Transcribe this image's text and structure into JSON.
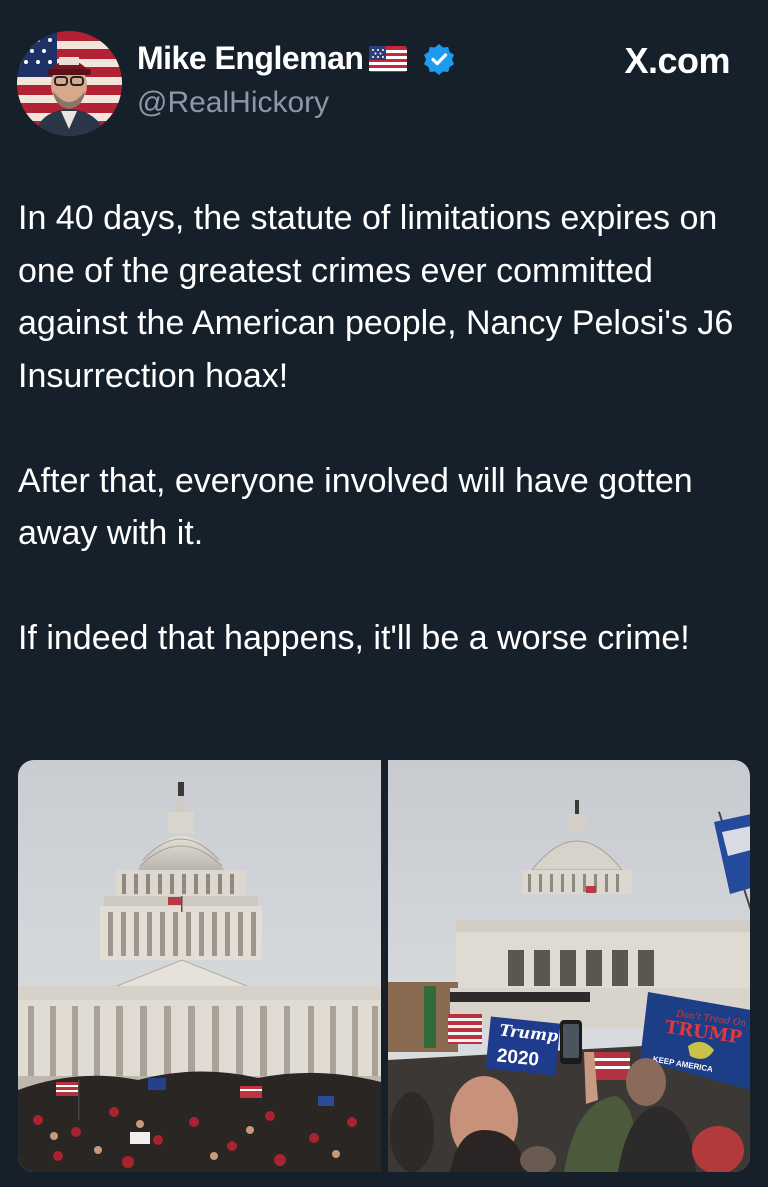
{
  "author": {
    "display_name": "Mike Engleman",
    "name_emoji": "us-flag-emoji",
    "handle": "@RealHickory",
    "verified_badge": "verified-check-icon"
  },
  "brand": {
    "label": "X.com"
  },
  "tweet": {
    "paragraphs": [
      "In 40 days, the statute of limitations expires on one of the greatest crimes ever committed against the American people, Nancy Pelosi's J6 Insurrection hoax!",
      "After that, everyone involved will have gotten away with it.",
      "If indeed that happens, it'll be a worse crime!"
    ]
  },
  "media": {
    "photo_1": {
      "subject": "capitol-building-crowd-photo"
    },
    "photo_2": {
      "subject": "capitol-crowd-flags-photo",
      "sign_text_1": "Trump",
      "sign_text_2": "2020",
      "flag_text_1": "Don't Tread On",
      "flag_text_2": "TRUMP",
      "flag_text_3": "KEEP AMERICA"
    }
  },
  "colors": {
    "background": "#16202b",
    "text_primary": "#ffffff",
    "text_secondary": "#8b98a5",
    "verified_blue": "#1d9bf0"
  }
}
